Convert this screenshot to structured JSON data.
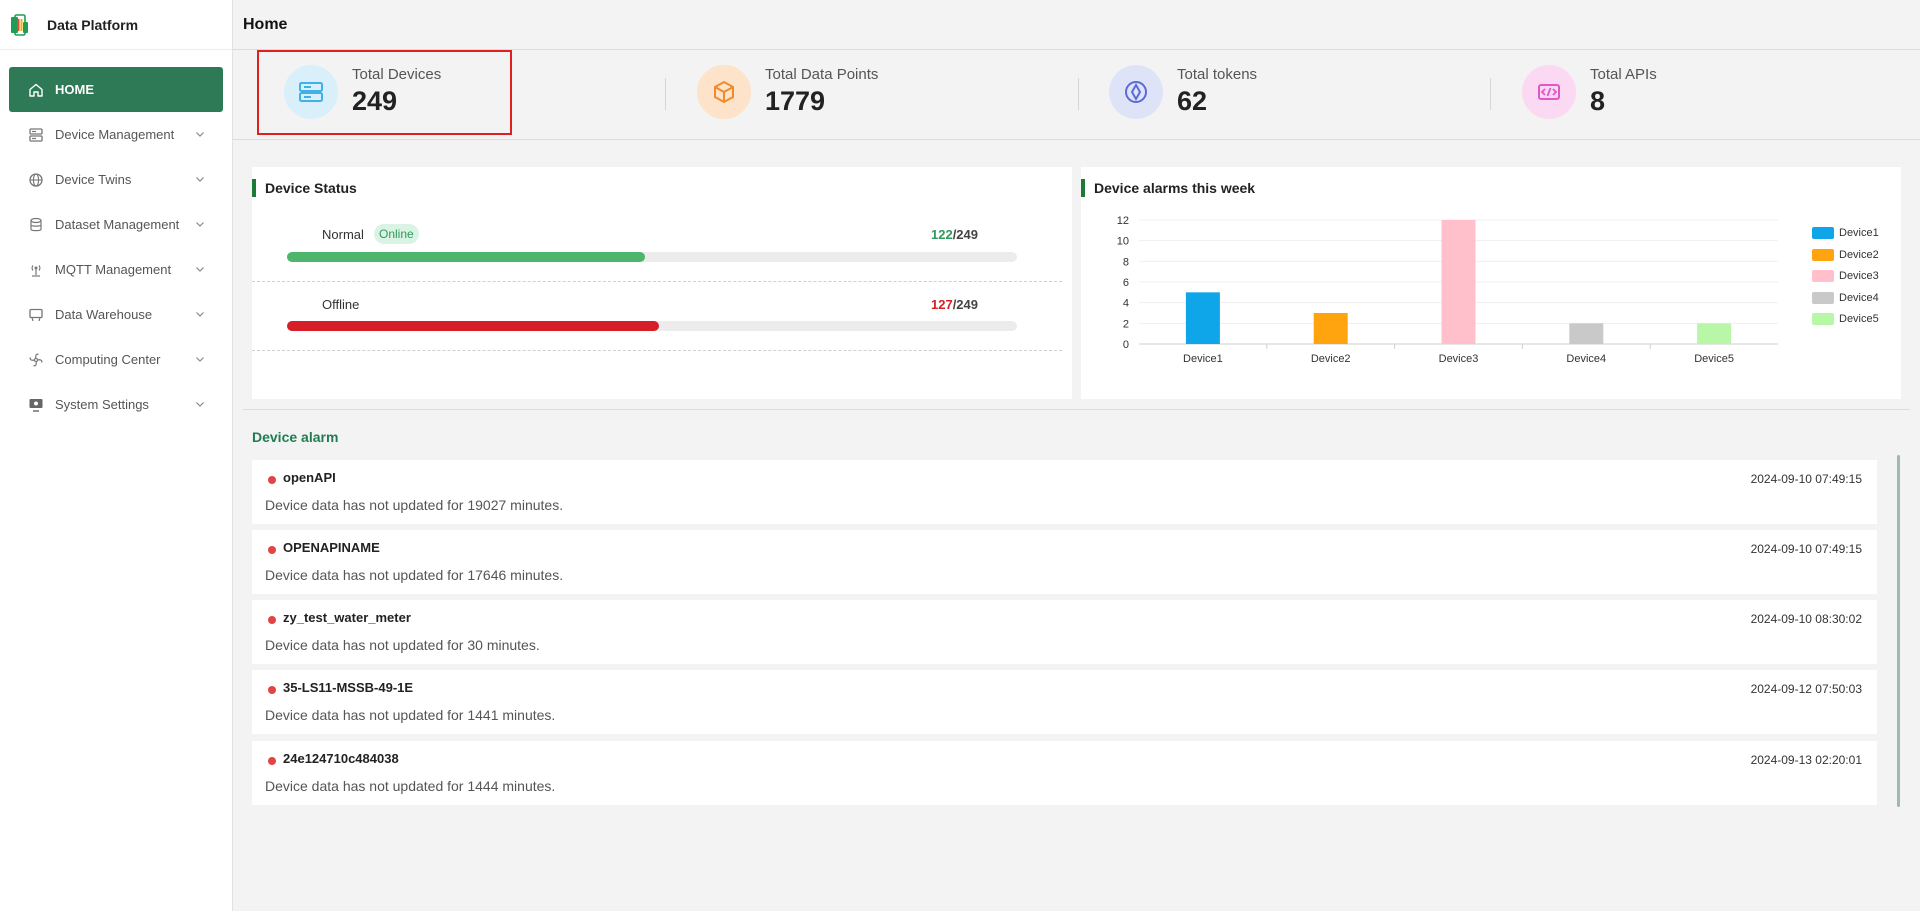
{
  "app": {
    "name": "Data Platform"
  },
  "sidebar": {
    "items": [
      {
        "label": "HOME",
        "icon": "home-icon",
        "active": true
      },
      {
        "label": "Device Management",
        "icon": "server-icon"
      },
      {
        "label": "Device Twins",
        "icon": "globe-icon"
      },
      {
        "label": "Dataset Management",
        "icon": "database-icon"
      },
      {
        "label": "MQTT Management",
        "icon": "broadcast-icon"
      },
      {
        "label": "Data Warehouse",
        "icon": "monitor-icon"
      },
      {
        "label": "Computing Center",
        "icon": "fan-icon"
      },
      {
        "label": "System Settings",
        "icon": "settings-screen-icon"
      }
    ]
  },
  "header": {
    "title": "Home"
  },
  "stats": [
    {
      "label": "Total Devices",
      "value": "249",
      "icon": "devices-icon",
      "color": "#3fb0e8"
    },
    {
      "label": "Total Data Points",
      "value": "1779",
      "icon": "cube-icon",
      "color": "#f28a2a"
    },
    {
      "label": "Total tokens",
      "value": "62",
      "icon": "token-icon",
      "color": "#5b6bd6"
    },
    {
      "label": "Total APIs",
      "value": "8",
      "icon": "code-icon",
      "color": "#e356c8"
    }
  ],
  "device_status": {
    "title": "Device Status",
    "rows": [
      {
        "label": "Normal",
        "badge": "Online",
        "count": "122",
        "total": "/249",
        "fraction": 0.49,
        "color": "#4db56c",
        "count_color": "#2f9a5b"
      },
      {
        "label": "Offline",
        "badge": "",
        "count": "127",
        "total": "/249",
        "fraction": 0.51,
        "color": "#d61f26",
        "count_color": "#d61f26"
      }
    ]
  },
  "alarms_chart": {
    "title": "Device alarms this week"
  },
  "chart_data": {
    "type": "bar",
    "categories": [
      "Device1",
      "Device2",
      "Device3",
      "Device4",
      "Device5"
    ],
    "values": [
      5,
      3,
      12,
      2,
      2
    ],
    "colors": [
      "#0ea5e9",
      "#ffa30f",
      "#ffc0cb",
      "#c9c9c9",
      "#b8f7a8"
    ],
    "title": "Device alarms this week",
    "xlabel": "",
    "ylabel": "",
    "ylim": [
      0,
      12
    ],
    "yticks": [
      "0",
      "2",
      "4",
      "6",
      "8",
      "10",
      "12"
    ],
    "legend": [
      "Device1",
      "Device2",
      "Device3",
      "Device4",
      "Device5"
    ],
    "legend_position": "right",
    "grid": true
  },
  "device_alarm": {
    "title": "Device alarm",
    "items": [
      {
        "name": "openAPI",
        "message": "Device data has not updated for 19027 minutes.",
        "time": "2024-09-10 07:49:15"
      },
      {
        "name": "OPENAPINAME",
        "message": "Device data has not updated for 17646 minutes.",
        "time": "2024-09-10 07:49:15"
      },
      {
        "name": "zy_test_water_meter",
        "message": "Device data has not updated for 30 minutes.",
        "time": "2024-09-10 08:30:02"
      },
      {
        "name": "35-LS11-MSSB-49-1E",
        "message": "Device data has not updated for 1441 minutes.",
        "time": "2024-09-12 07:50:03"
      },
      {
        "name": "24e124710c484038",
        "message": "Device data has not updated for 1444 minutes.",
        "time": "2024-09-13 02:20:01"
      }
    ]
  }
}
